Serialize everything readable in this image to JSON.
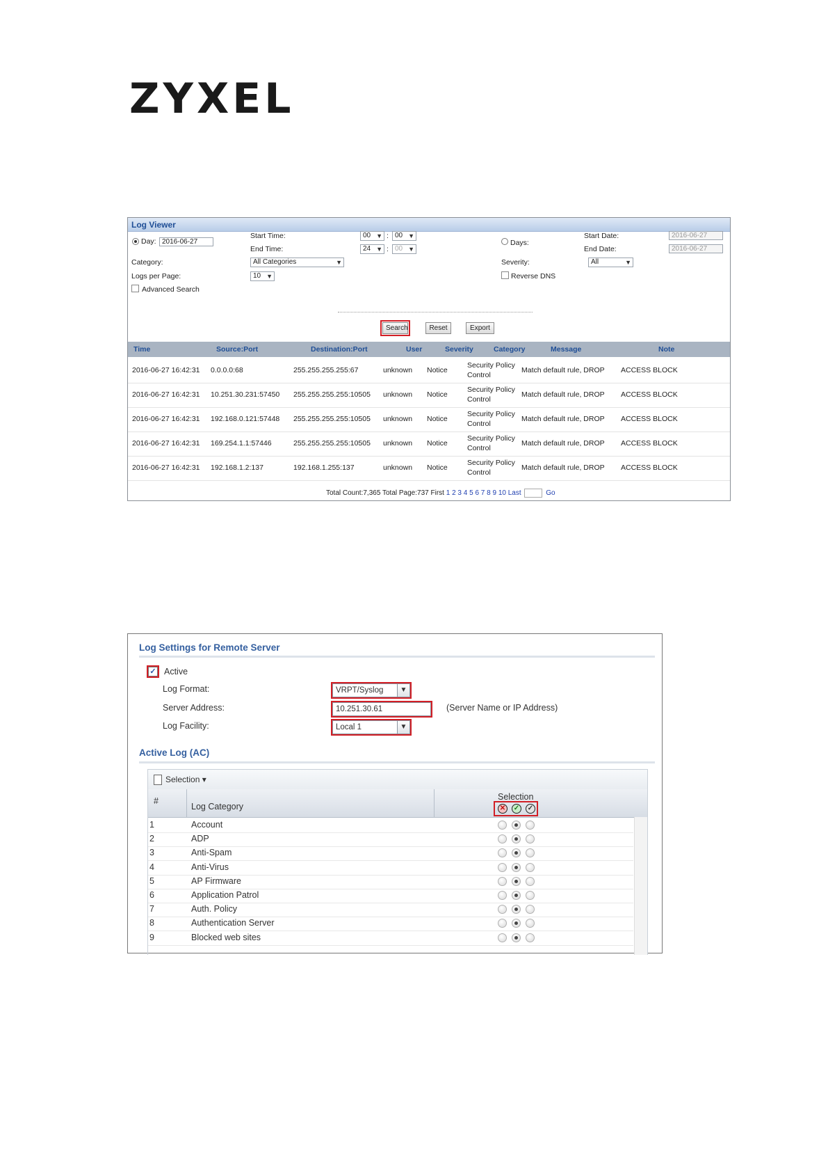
{
  "brand": "ZYXEL",
  "log_viewer": {
    "title": "Log Viewer",
    "day_label": "Day:",
    "day_value": "2016-06-27",
    "start_time_label": "Start Time:",
    "end_time_label": "End Time:",
    "start_hour": "00",
    "start_min": "00",
    "end_hour": "24",
    "end_min": "00",
    "time_sep": ":",
    "days_label": "Days:",
    "start_date_label": "Start Date:",
    "end_date_label": "End Date:",
    "start_date": "2016-06-27",
    "end_date": "2016-06-27",
    "category_label": "Category:",
    "category_value": "All Categories",
    "severity_label": "Severity:",
    "severity_value": "All",
    "logs_per_page_label": "Logs per Page:",
    "logs_per_page_value": "10",
    "reverse_dns_label": "Reverse DNS",
    "advanced_search_label": "Advanced Search",
    "search_btn": "Search",
    "reset_btn": "Reset",
    "export_btn": "Export",
    "columns": [
      "Time",
      "Source:Port",
      "Destination:Port",
      "User",
      "Severity",
      "Category",
      "Message",
      "Note"
    ],
    "rows": [
      {
        "time": "2016-06-27 16:42:31",
        "source": "0.0.0.0:68",
        "dest": "255.255.255.255:67",
        "user": "unknown",
        "severity": "Notice",
        "category": "Security Policy Control",
        "message": "Match default rule, DROP",
        "note": "ACCESS BLOCK"
      },
      {
        "time": "2016-06-27 16:42:31",
        "source": "10.251.30.231:57450",
        "dest": "255.255.255.255:10505",
        "user": "unknown",
        "severity": "Notice",
        "category": "Security Policy Control",
        "message": "Match default rule, DROP",
        "note": "ACCESS BLOCK"
      },
      {
        "time": "2016-06-27 16:42:31",
        "source": "192.168.0.121:57448",
        "dest": "255.255.255.255:10505",
        "user": "unknown",
        "severity": "Notice",
        "category": "Security Policy Control",
        "message": "Match default rule, DROP",
        "note": "ACCESS BLOCK"
      },
      {
        "time": "2016-06-27 16:42:31",
        "source": "169.254.1.1:57446",
        "dest": "255.255.255.255:10505",
        "user": "unknown",
        "severity": "Notice",
        "category": "Security Policy Control",
        "message": "Match default rule, DROP",
        "note": "ACCESS BLOCK"
      },
      {
        "time": "2016-06-27 16:42:31",
        "source": "192.168.1.2:137",
        "dest": "192.168.1.255:137",
        "user": "unknown",
        "severity": "Notice",
        "category": "Security Policy Control",
        "message": "Match default rule, DROP",
        "note": "ACCESS BLOCK"
      }
    ],
    "pager": {
      "total_text": "Total Count:7,365 Total Page:737",
      "first": "First",
      "pages": [
        "1",
        "2",
        "3",
        "4",
        "5",
        "6",
        "7",
        "8",
        "9",
        "10"
      ],
      "last": "Last",
      "go": "Go"
    }
  },
  "log_settings": {
    "title": "Log Settings for Remote Server",
    "active_label": "Active",
    "log_format_label": "Log Format:",
    "log_format_value": "VRPT/Syslog",
    "server_address_label": "Server Address:",
    "server_address_value": "10.251.30.61",
    "server_address_hint": "(Server Name or IP Address)",
    "log_facility_label": "Log Facility:",
    "log_facility_value": "Local 1",
    "active_log_title": "Active Log (AC)",
    "selection_menu": "Selection",
    "col_num": "#",
    "col_category": "Log Category",
    "col_selection": "Selection",
    "categories": [
      {
        "num": "1",
        "name": "Account"
      },
      {
        "num": "2",
        "name": "ADP"
      },
      {
        "num": "3",
        "name": "Anti-Spam"
      },
      {
        "num": "4",
        "name": "Anti-Virus"
      },
      {
        "num": "5",
        "name": "AP Firmware"
      },
      {
        "num": "6",
        "name": "Application Patrol"
      },
      {
        "num": "7",
        "name": "Auth. Policy"
      },
      {
        "num": "8",
        "name": "Authentication Server"
      },
      {
        "num": "9",
        "name": "Blocked web sites"
      }
    ],
    "highlight_color": "#d21f26"
  }
}
